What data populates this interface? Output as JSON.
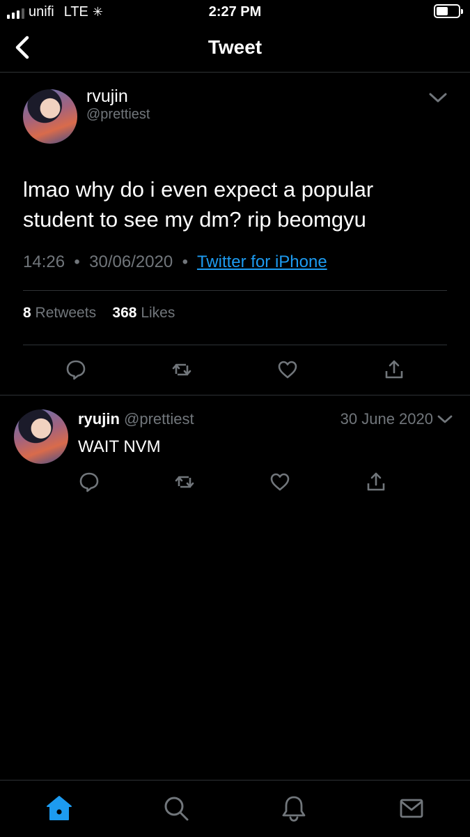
{
  "status_bar": {
    "carrier": "unifi",
    "network": "LTE",
    "time": "2:27 PM"
  },
  "header": {
    "title": "Tweet"
  },
  "tweet": {
    "name": "rvujin",
    "handle": "@prettiest",
    "text": "lmao why do i even expect a popular student to see my dm? rip beomgyu",
    "time": "14:26",
    "date": "30/06/2020",
    "source": "Twitter for iPhone",
    "retweets_count": "8",
    "retweets_label": "Retweets",
    "likes_count": "368",
    "likes_label": "Likes"
  },
  "reply": {
    "name": "ryujin",
    "handle": "@prettiest",
    "date": "30 June 2020",
    "text": "WAIT NVM"
  },
  "colors": {
    "background": "#000000",
    "accent": "#1d9bf0",
    "muted": "#71767b",
    "divider": "#2f3336"
  },
  "icons": {
    "back": "chevron-left-icon",
    "more": "chevron-down-icon",
    "reply": "comment-icon",
    "retweet": "retweet-icon",
    "like": "heart-icon",
    "share": "share-icon",
    "home": "home-icon",
    "search": "search-icon",
    "notifications": "bell-icon",
    "messages": "mail-icon"
  }
}
